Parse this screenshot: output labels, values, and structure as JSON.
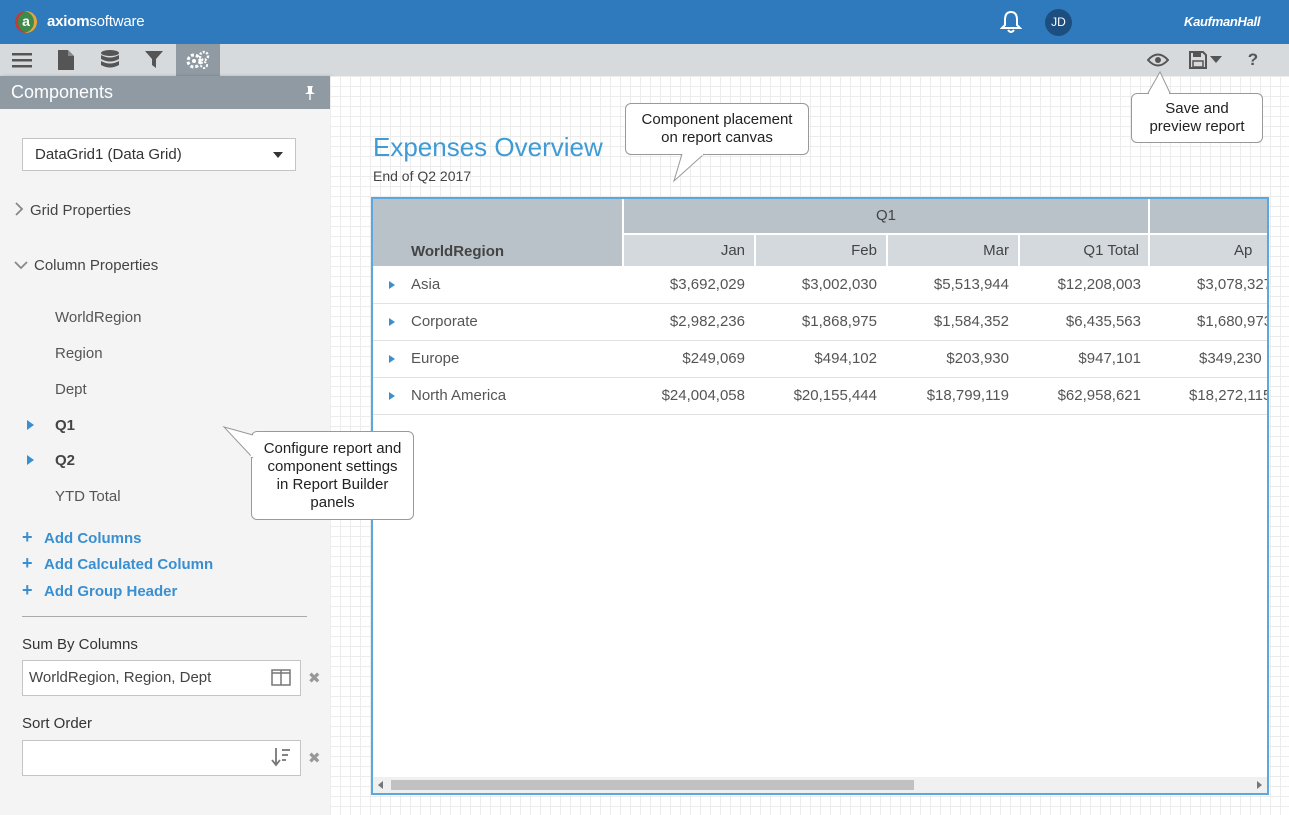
{
  "topbar": {
    "logo_letter": "a",
    "brand_bold": "axiom",
    "brand_light": "software",
    "bell_icon": "bell-icon",
    "user_initials": "JD",
    "partner_logo": "KaufmanHall"
  },
  "toolbar": {
    "left_icons": [
      "menu-icon",
      "document-icon",
      "database-icon",
      "filter-icon",
      "settings-icon"
    ],
    "right_icons": [
      "eye-icon",
      "save-icon",
      "help-icon"
    ],
    "help_label": "?"
  },
  "panel": {
    "title": "Components",
    "component_select": "DataGrid1 (Data Grid)",
    "grid_properties": "Grid Properties",
    "column_properties": "Column Properties",
    "columns": [
      {
        "label": "WorldRegion"
      },
      {
        "label": "Region"
      },
      {
        "label": "Dept"
      },
      {
        "label": "Q1"
      },
      {
        "label": "Q2"
      },
      {
        "label": "YTD Total"
      }
    ],
    "add_columns": "Add Columns",
    "add_calculated_column": "Add Calculated Column",
    "add_group_header": "Add Group Header",
    "sum_by_label": "Sum By Columns",
    "sum_by_value": "WorldRegion, Region, Dept",
    "sort_order_label": "Sort Order",
    "sort_order_value": ""
  },
  "report": {
    "title": "Expenses Overview",
    "subtitle": "End of Q2 2017"
  },
  "grid": {
    "group_header": "Q1",
    "row_header": "WorldRegion",
    "columns": [
      "Jan",
      "Feb",
      "Mar",
      "Q1 Total",
      "Ap"
    ],
    "rows": [
      {
        "label": "Asia",
        "values": [
          "$3,692,029",
          "$3,002,030",
          "$5,513,944",
          "$12,208,003",
          "$3,078,327"
        ]
      },
      {
        "label": "Corporate",
        "values": [
          "$2,982,236",
          "$1,868,975",
          "$1,584,352",
          "$6,435,563",
          "$1,680,973"
        ]
      },
      {
        "label": "Europe",
        "values": [
          "$249,069",
          "$494,102",
          "$203,930",
          "$947,101",
          "$349,230"
        ]
      },
      {
        "label": "North America",
        "values": [
          "$24,004,058",
          "$20,155,444",
          "$18,799,119",
          "$62,958,621",
          "$18,272,115"
        ]
      }
    ]
  },
  "callouts": {
    "placement": [
      "Component placement",
      "on report canvas"
    ],
    "save": [
      "Save and",
      "preview report"
    ],
    "configure": [
      "Configure report and",
      "component settings",
      "in Report Builder",
      "panels"
    ]
  },
  "colors": {
    "topbar": "#2f7abd",
    "accent": "#3d9bd6",
    "panel_header": "#8f9aa3",
    "grid_header": "#b9c2c9"
  }
}
